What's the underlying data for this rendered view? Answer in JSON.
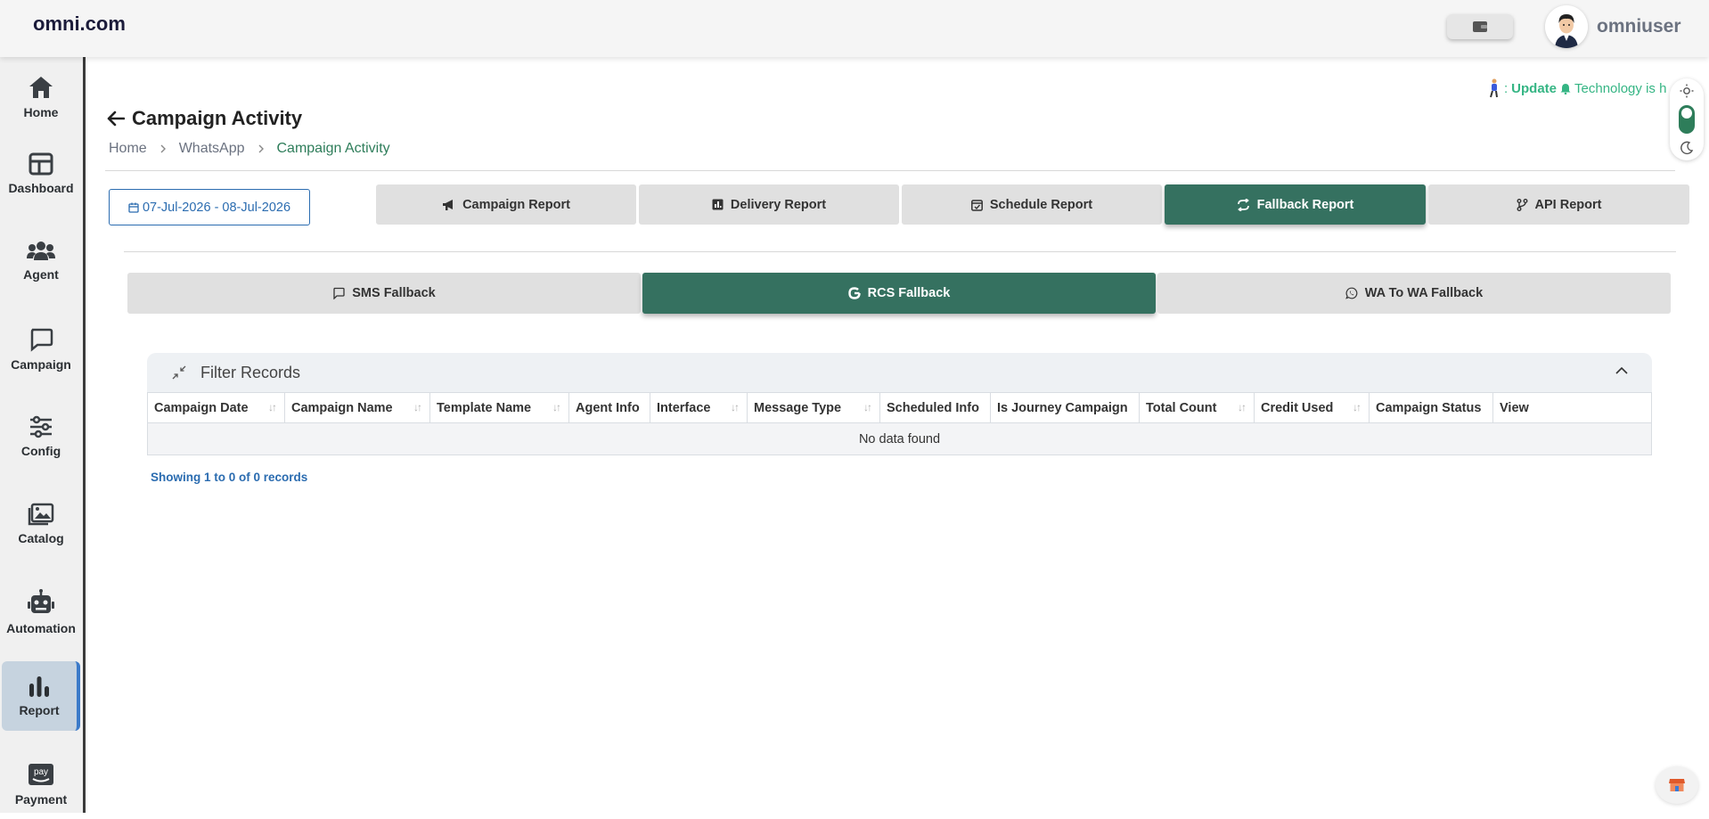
{
  "header": {
    "brand": "omni.com",
    "username": "omniuser"
  },
  "sidebar": {
    "items": [
      {
        "label": "Home",
        "icon": "home-icon"
      },
      {
        "label": "Dashboard",
        "icon": "dashboard-icon"
      },
      {
        "label": "Agent",
        "icon": "users-icon"
      },
      {
        "label": "Campaign",
        "icon": "chat-icon"
      },
      {
        "label": "Config",
        "icon": "sliders-icon"
      },
      {
        "label": "Catalog",
        "icon": "image-icon"
      },
      {
        "label": "Automation",
        "icon": "robot-icon"
      },
      {
        "label": "Report",
        "icon": "bar-chart-icon",
        "active": true
      },
      {
        "label": "Payment",
        "icon": "amazon-pay-icon"
      }
    ]
  },
  "ticker": {
    "prefix": ":",
    "highlight": "Update",
    "text": "Technology is h"
  },
  "page": {
    "title": "Campaign Activity",
    "breadcrumb": [
      "Home",
      "WhatsApp",
      "Campaign Activity"
    ]
  },
  "date_range": "07-Jul-2026 - 08-Jul-2026",
  "report_tabs": [
    {
      "label": "Campaign Report",
      "icon": "megaphone-icon"
    },
    {
      "label": "Delivery Report",
      "icon": "report-icon"
    },
    {
      "label": "Schedule Report",
      "icon": "calendar-check-icon"
    },
    {
      "label": "Fallback Report",
      "icon": "refresh-icon",
      "active": true
    },
    {
      "label": "API Report",
      "icon": "branch-icon"
    }
  ],
  "fallback_tabs": [
    {
      "label": "SMS Fallback",
      "icon": "message-icon"
    },
    {
      "label": "RCS Fallback",
      "icon": "google-icon",
      "active": true
    },
    {
      "label": "WA To WA Fallback",
      "icon": "whatsapp-icon"
    }
  ],
  "filter": {
    "title": "Filter Records"
  },
  "table": {
    "columns": [
      {
        "label": "Campaign Date",
        "sortable": true
      },
      {
        "label": "Campaign Name",
        "sortable": true
      },
      {
        "label": "Template Name",
        "sortable": true
      },
      {
        "label": "Agent Info",
        "sortable": false
      },
      {
        "label": "Interface",
        "sortable": true
      },
      {
        "label": "Message Type",
        "sortable": true
      },
      {
        "label": "Scheduled Info",
        "sortable": false
      },
      {
        "label": "Is Journey Campaign",
        "sortable": false
      },
      {
        "label": "Total Count",
        "sortable": true
      },
      {
        "label": "Credit Used",
        "sortable": true
      },
      {
        "label": "Campaign Status",
        "sortable": false
      },
      {
        "label": "View",
        "sortable": false
      }
    ],
    "empty_text": "No data found",
    "records_info": "Showing 1 to 0 of 0 records"
  },
  "colors": {
    "accent": "#357160",
    "link": "#2b6cb0",
    "ticker": "#35b584"
  }
}
